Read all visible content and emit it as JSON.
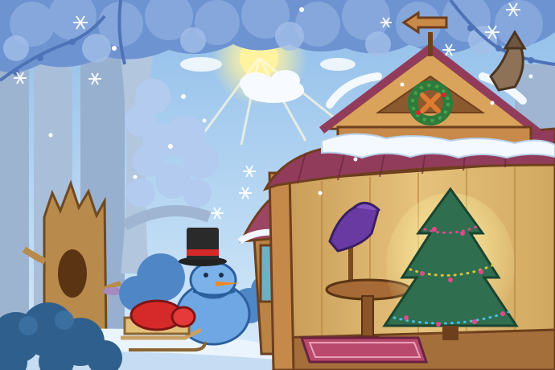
{
  "scene": {
    "colors": {
      "sky_top": "#9ec9ef",
      "sky_bottom": "#d8ecfa",
      "foliage": "#6f95d3",
      "foliage_light": "#a9c4ec",
      "trunk": "#8ea8c8",
      "snow": "#eef6fd",
      "snow_shadow": "#b9d2ee",
      "wood": "#b97a45",
      "wood_dark": "#6e3f1d",
      "roof": "#8c3a5a",
      "wall_inner": "#d9b36c",
      "tree_green": "#2f6e4e",
      "hat_purple": "#6a3aa3",
      "sack_red": "#d42a2a",
      "sun": "#fff2a0"
    },
    "icons": {
      "weathervane": "arrow-sign-icon",
      "wreath": "wreath-icon",
      "snowman": "snowman-icon",
      "sled": "sled-icon",
      "christmas_tree": "christmas-tree-icon",
      "hat": "wizard-hat-icon",
      "table": "round-table-icon",
      "rug": "rug-icon",
      "chimney": "chimney-icon",
      "stump": "hollow-stump-icon",
      "snowflake": "snowflake-icon",
      "sun": "sun-icon"
    }
  }
}
